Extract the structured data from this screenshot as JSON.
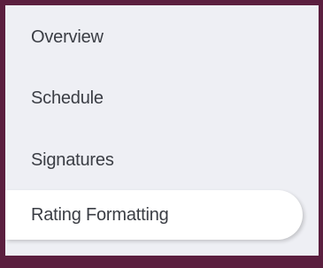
{
  "sidebar": {
    "items": [
      {
        "label": "Overview",
        "active": false
      },
      {
        "label": "Schedule",
        "active": false
      },
      {
        "label": "Signatures",
        "active": false
      },
      {
        "label": "Rating Formatting",
        "active": true
      }
    ]
  },
  "colors": {
    "frame_border": "#5b1f3f",
    "panel_background": "#eeeff4",
    "active_item_background": "#ffffff",
    "text": "#3a3d44"
  }
}
